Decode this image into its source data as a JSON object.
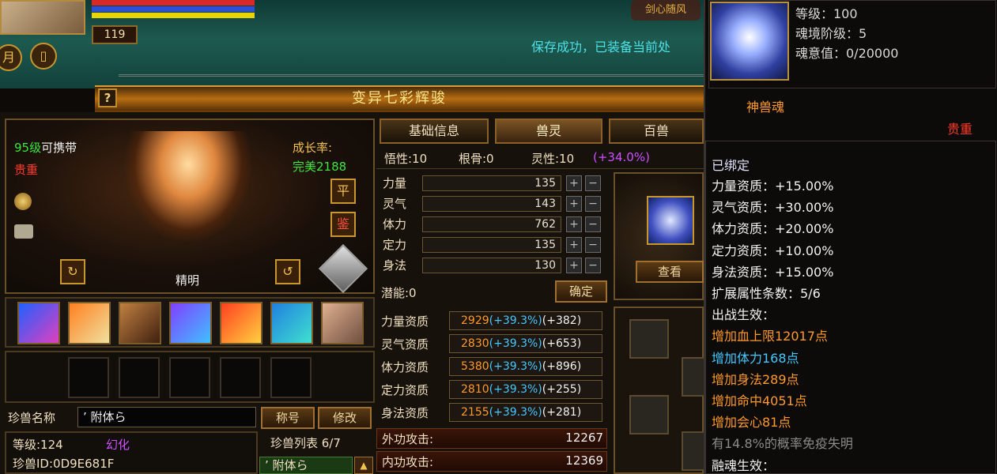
{
  "hud": {
    "level": "119",
    "status_message": "保存成功，已装备当前处",
    "logo_text": "剑心随风",
    "side_button_1": "月",
    "side_button_2": "▯"
  },
  "window": {
    "title": "变异七彩辉骏",
    "help_label": "?"
  },
  "pet_view": {
    "carry_level": "95级",
    "carry_text": "可携带",
    "rarity": "贵重",
    "growth_label": "成长率:",
    "growth_value": "完美2188",
    "btn_ping": "平",
    "btn_jian": "鉴",
    "personality": "精明",
    "rotate_left": "↻",
    "rotate_right": "↺"
  },
  "skills": [
    "skill-1",
    "skill-2",
    "skill-3",
    "skill-4",
    "skill-5",
    "skill-6",
    "skill-7"
  ],
  "name_row": {
    "label": "珍兽名称",
    "name_value": "’ 附体ら",
    "btn_title": "称号",
    "btn_rename": "修改"
  },
  "info": {
    "level_label": "等级:124",
    "transform": "幻化",
    "pet_id": "珍兽ID:0D9E681F",
    "list_label": "珍兽列表 6/7",
    "list_item": "’ 附体ら"
  },
  "tabs": [
    {
      "label": "基础信息"
    },
    {
      "label": "兽灵"
    },
    {
      "label": "百兽"
    }
  ],
  "base_stats": {
    "wuxing": "悟性:10",
    "gengu": "根骨:0",
    "lingxing": "灵性:10",
    "lingxing_bonus": "(+34.0%)"
  },
  "attributes": [
    {
      "label": "力量",
      "value": "135"
    },
    {
      "label": "灵气",
      "value": "143"
    },
    {
      "label": "体力",
      "value": "762"
    },
    {
      "label": "定力",
      "value": "135"
    },
    {
      "label": "身法",
      "value": "130"
    }
  ],
  "potential": {
    "label": "潜能:0",
    "confirm": "确定"
  },
  "aptitudes": [
    {
      "label": "力量资质",
      "base": "2929",
      "pct": "(+39.3%)",
      "extra": "(+382)"
    },
    {
      "label": "灵气资质",
      "base": "2830",
      "pct": "(+39.3%)",
      "extra": "(+653)"
    },
    {
      "label": "体力资质",
      "base": "5380",
      "pct": "(+39.3%)",
      "extra": "(+896)"
    },
    {
      "label": "定力资质",
      "base": "2810",
      "pct": "(+39.3%)",
      "extra": "(+255)"
    },
    {
      "label": "身法资质",
      "base": "2155",
      "pct": "(+39.3%)",
      "extra": "(+281)"
    }
  ],
  "attacks": [
    {
      "label": "外功攻击:",
      "value": "12267"
    },
    {
      "label": "内功攻击:",
      "value": "12369"
    }
  ],
  "soul_panel": {
    "view_button": "查看"
  },
  "tooltip": {
    "level": "等级：100",
    "stage": "魂境阶级：5",
    "soul_value": "魂意值：0/20000",
    "item_name": "神兽魂",
    "rarity": "贵重",
    "bound": "已绑定",
    "lines": [
      {
        "text": "力量资质：+15.00%",
        "color": "#f2f2f2"
      },
      {
        "text": "灵气资质：+30.00%",
        "color": "#f2f2f2"
      },
      {
        "text": "体力资质：+20.00%",
        "color": "#f2f2f2"
      },
      {
        "text": "定力资质：+10.00%",
        "color": "#f2f2f2"
      },
      {
        "text": "身法资质：+15.00%",
        "color": "#f2f2f2"
      },
      {
        "text": "扩展属性条数：5/6",
        "color": "#f2f2f2"
      },
      {
        "text": "出战生效：",
        "color": "#f2f2f2"
      },
      {
        "text": "增加血上限12017点",
        "color": "#ff9a2a"
      },
      {
        "text": "增加体力168点",
        "color": "#44c8ff"
      },
      {
        "text": "增加身法289点",
        "color": "#ff9a2a"
      },
      {
        "text": "增加命中4051点",
        "color": "#ff9a2a"
      },
      {
        "text": "增加会心81点",
        "color": "#ff9a2a"
      },
      {
        "text": "有14.8%的概率免疫失明",
        "color": "#8a8a8a"
      },
      {
        "text": "融魂生效：",
        "color": "#f2f2f2"
      }
    ]
  }
}
